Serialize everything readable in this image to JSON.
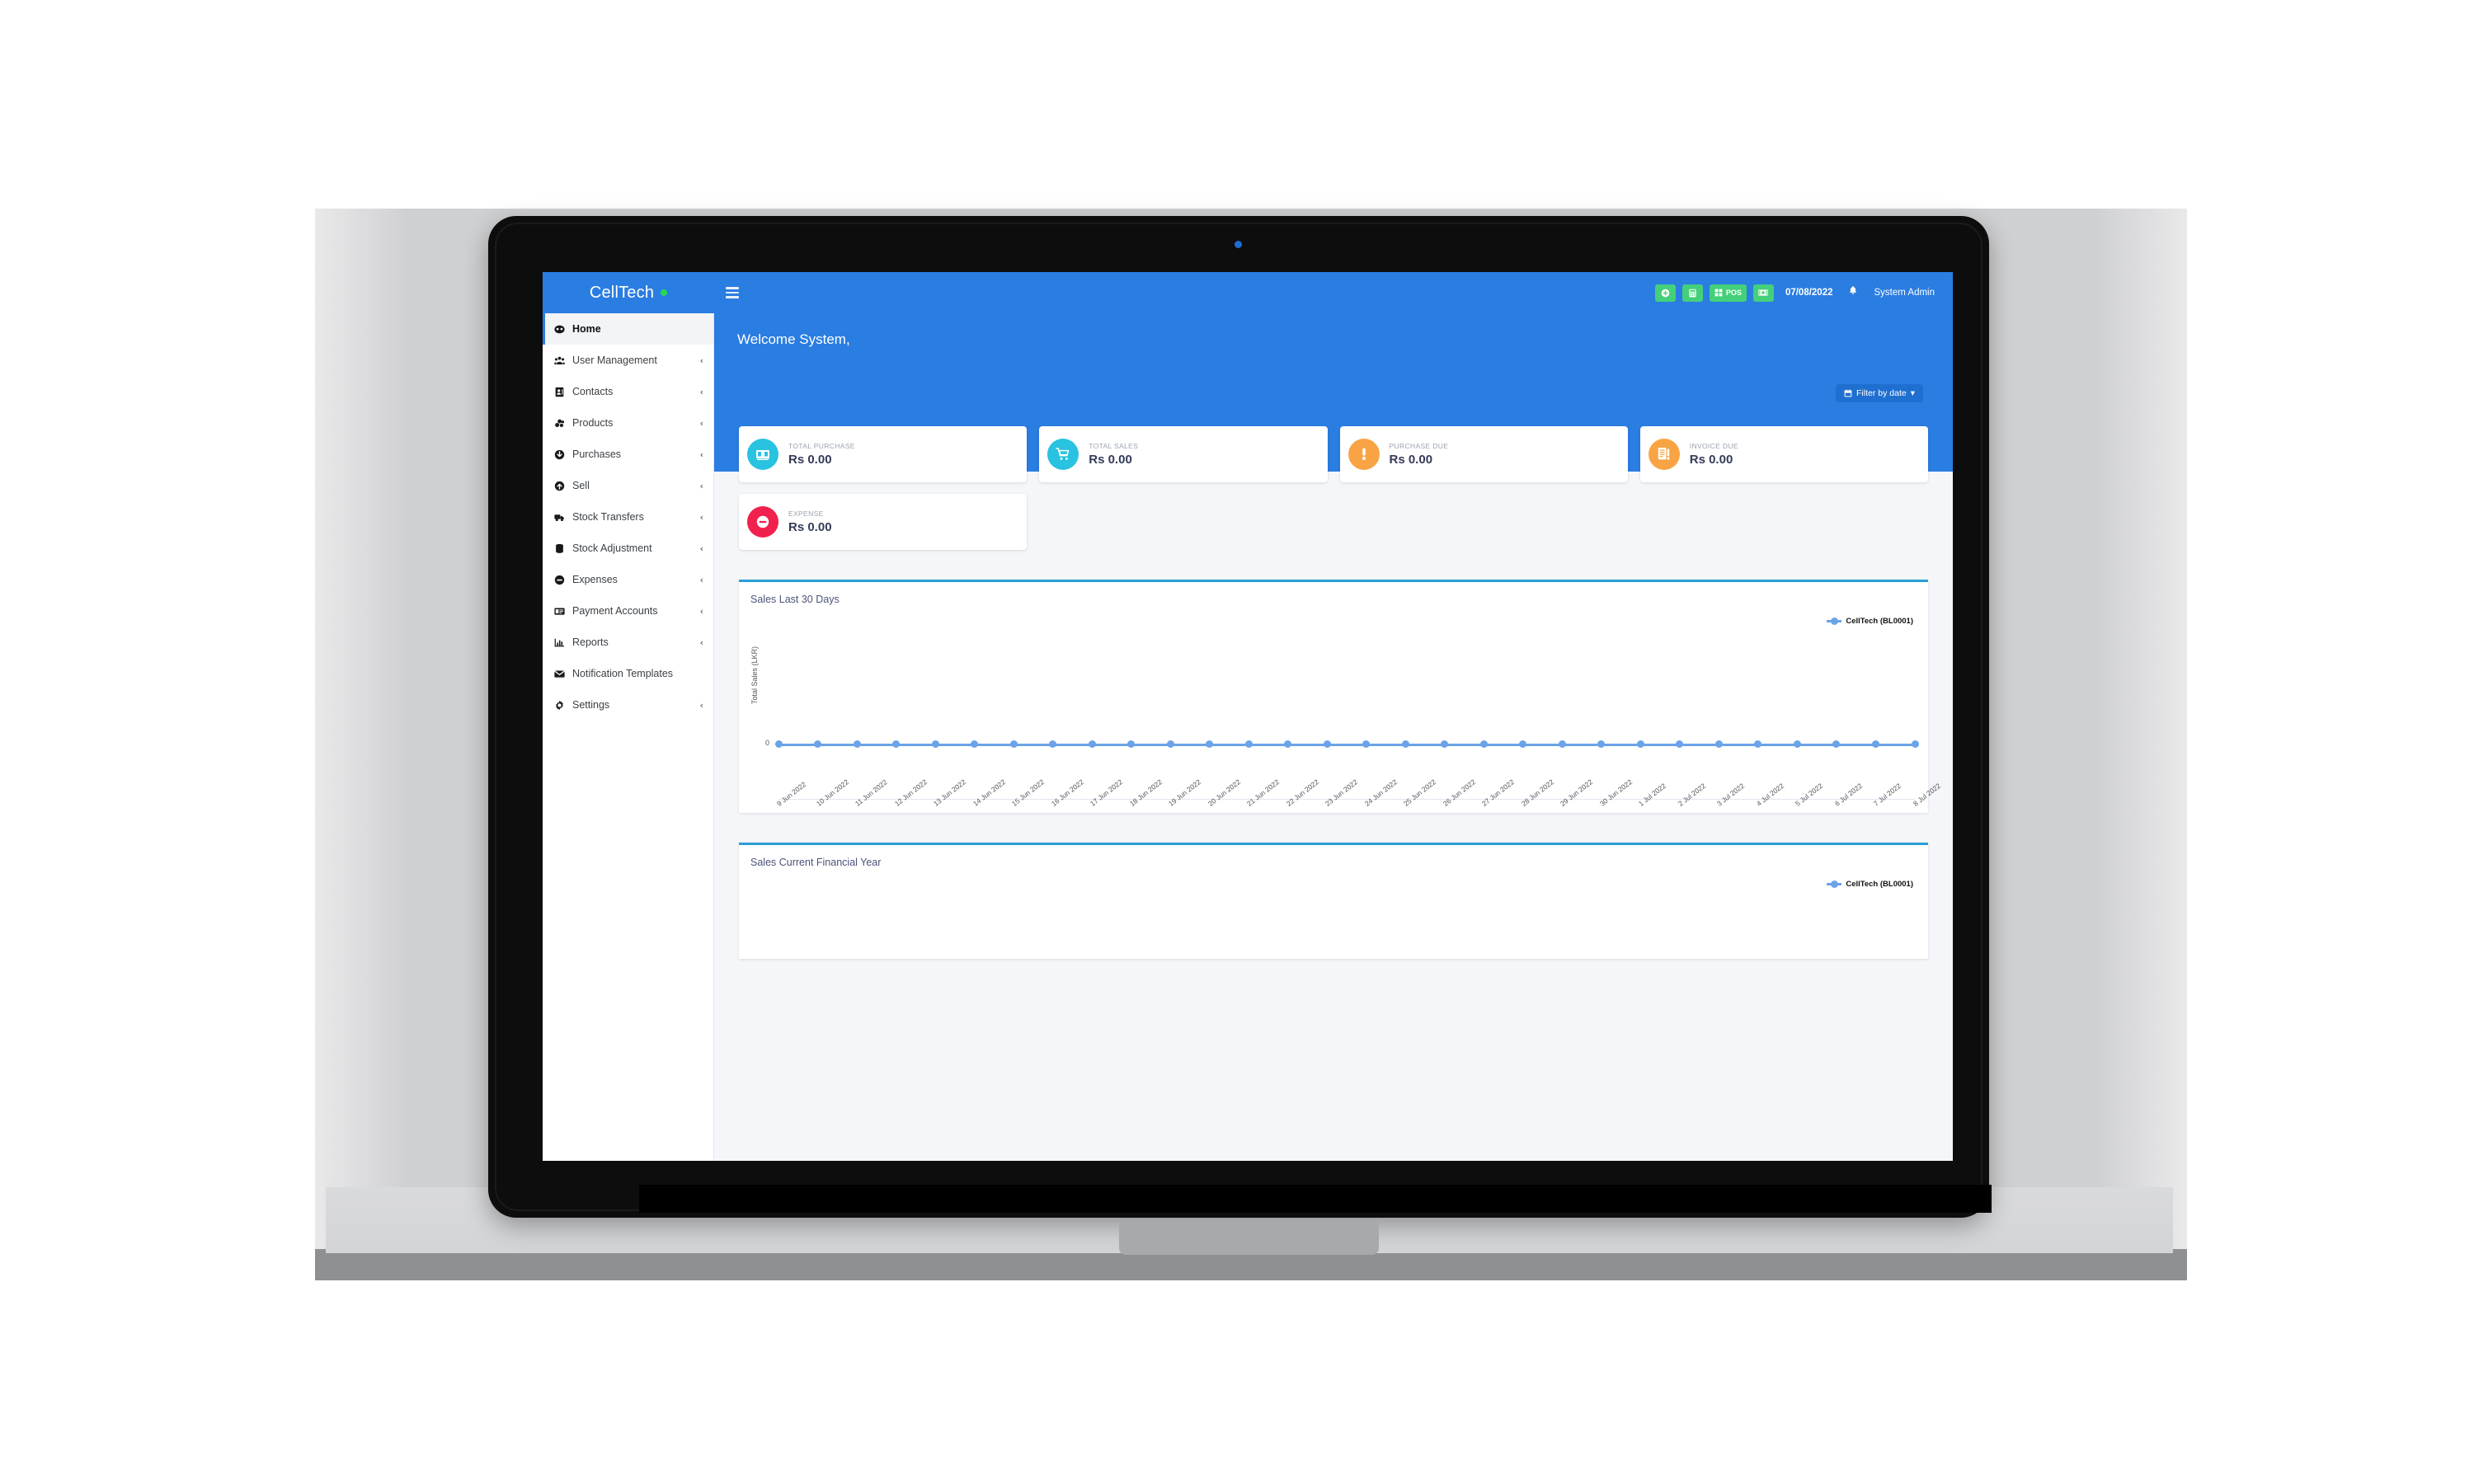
{
  "brand": {
    "name": "CellTech",
    "status_dot_color": "#27d94f"
  },
  "topbar": {
    "menu_toggle": "hamburger-menu",
    "actions": [
      {
        "name": "add-button",
        "icon": "plus-circle-icon",
        "label": ""
      },
      {
        "name": "calculator-button",
        "icon": "calculator-icon",
        "label": ""
      },
      {
        "name": "pos-button",
        "icon": "grid-icon",
        "label": "POS"
      },
      {
        "name": "cash-register-button",
        "icon": "banknote-icon",
        "label": ""
      }
    ],
    "date": "07/08/2022",
    "notification_icon": "bell-icon",
    "user": "System Admin"
  },
  "sidebar": {
    "items": [
      {
        "label": "Home",
        "icon": "dashboard-icon",
        "active": true,
        "caret": false
      },
      {
        "label": "User Management",
        "icon": "users-icon",
        "active": false,
        "caret": true
      },
      {
        "label": "Contacts",
        "icon": "contact-card-icon",
        "active": false,
        "caret": true
      },
      {
        "label": "Products",
        "icon": "cubes-icon",
        "active": false,
        "caret": true
      },
      {
        "label": "Purchases",
        "icon": "arrow-down-circle-icon",
        "active": false,
        "caret": true
      },
      {
        "label": "Sell",
        "icon": "arrow-up-circle-icon",
        "active": false,
        "caret": true
      },
      {
        "label": "Stock Transfers",
        "icon": "truck-icon",
        "active": false,
        "caret": true
      },
      {
        "label": "Stock Adjustment",
        "icon": "database-icon",
        "active": false,
        "caret": true
      },
      {
        "label": "Expenses",
        "icon": "minus-circle-icon",
        "active": false,
        "caret": true
      },
      {
        "label": "Payment Accounts",
        "icon": "payment-card-icon",
        "active": false,
        "caret": true
      },
      {
        "label": "Reports",
        "icon": "bar-chart-icon",
        "active": false,
        "caret": true
      },
      {
        "label": "Notification Templates",
        "icon": "envelope-icon",
        "active": false,
        "caret": false
      },
      {
        "label": "Settings",
        "icon": "gear-icon",
        "active": false,
        "caret": true
      }
    ],
    "caret_glyph": "‹"
  },
  "hero": {
    "welcome": "Welcome System,",
    "filter_label": "Filter by date",
    "filter_icon": "calendar-icon",
    "filter_caret": "▾"
  },
  "stats": {
    "row1": [
      {
        "label": "TOTAL PURCHASE",
        "value": "Rs 0.00",
        "icon": "money-bill-icon",
        "color": "#29c2e0"
      },
      {
        "label": "TOTAL SALES",
        "value": "Rs 0.00",
        "icon": "shopping-cart-icon",
        "color": "#29c2e0"
      },
      {
        "label": "PURCHASE DUE",
        "value": "Rs 0.00",
        "icon": "exclamation-icon",
        "color": "#f8a444"
      },
      {
        "label": "INVOICE DUE",
        "value": "Rs 0.00",
        "icon": "invoice-icon",
        "color": "#f8a444"
      }
    ],
    "row2": [
      {
        "label": "EXPENSE",
        "value": "Rs 0.00",
        "icon": "minus-circle-icon",
        "color": "#f0214d"
      }
    ]
  },
  "panels": [
    {
      "title": "Sales Last 30 Days"
    },
    {
      "title": "Sales Current Financial Year"
    }
  ],
  "chart_data": {
    "type": "line",
    "title": "Sales Last 30 Days",
    "xlabel": "",
    "ylabel": "Total Sales (LKR)",
    "ylim": [
      0,
      0
    ],
    "yticks": [
      "0"
    ],
    "grid": false,
    "legend_position": "top-right",
    "legend": [
      "CellTech (BL0001)"
    ],
    "series": [
      {
        "name": "CellTech (BL0001)",
        "color": "#6ba3e8",
        "values": [
          0,
          0,
          0,
          0,
          0,
          0,
          0,
          0,
          0,
          0,
          0,
          0,
          0,
          0,
          0,
          0,
          0,
          0,
          0,
          0,
          0,
          0,
          0,
          0,
          0,
          0,
          0,
          0,
          0,
          0
        ]
      }
    ],
    "categories": [
      "9 Jun 2022",
      "10 Jun 2022",
      "11 Jun 2022",
      "12 Jun 2022",
      "13 Jun 2022",
      "14 Jun 2022",
      "15 Jun 2022",
      "16 Jun 2022",
      "17 Jun 2022",
      "18 Jun 2022",
      "19 Jun 2022",
      "20 Jun 2022",
      "21 Jun 2022",
      "22 Jun 2022",
      "23 Jun 2022",
      "24 Jun 2022",
      "25 Jun 2022",
      "26 Jun 2022",
      "27 Jun 2022",
      "28 Jun 2022",
      "29 Jun 2022",
      "30 Jun 2022",
      "1 Jul 2022",
      "2 Jul 2022",
      "3 Jul 2022",
      "4 Jul 2022",
      "5 Jul 2022",
      "6 Jul 2022",
      "7 Jul 2022",
      "8 Jul 2022"
    ]
  },
  "chart2_data": {
    "type": "line",
    "title": "Sales Current Financial Year",
    "ylabel": "",
    "legend": [
      "CellTech (BL0001)"
    ],
    "series": [
      {
        "name": "CellTech (BL0001)",
        "color": "#6ba3e8",
        "values": []
      }
    ],
    "categories": []
  }
}
